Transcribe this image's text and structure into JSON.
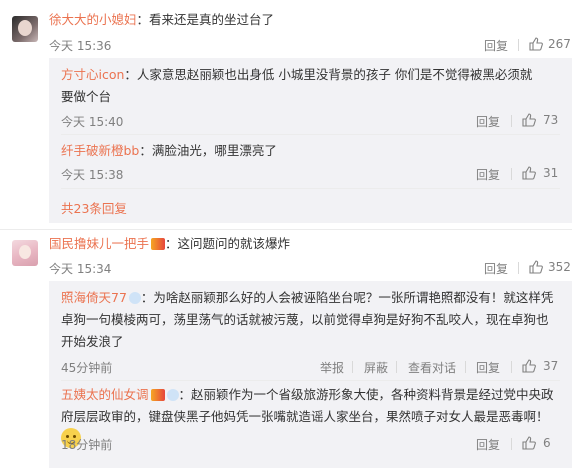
{
  "comments": [
    {
      "user": "徐大大的小媳妇",
      "text": "：看来还是真的坐过台了",
      "time": "今天 15:36",
      "reply_label": "回复",
      "likes": "267",
      "replies": [
        {
          "user": "方寸心icon",
          "text": "：人家意思赵丽颖也出身低 小城里没背景的孩子 你们是不觉得被黑必须就要做个台",
          "time": "今天 15:40",
          "reply_label": "回复",
          "likes": "73"
        },
        {
          "user": "纤手破新橙bb",
          "text": "：满脸油光，哪里漂亮了",
          "time": "今天 15:38",
          "reply_label": "回复",
          "likes": "31"
        }
      ],
      "more_replies": "共23条回复"
    },
    {
      "user": "国民撸妹儿一把手",
      "text": "：这问题问的就该爆炸",
      "time": "今天 15:34",
      "reply_label": "回复",
      "likes": "352",
      "replies": [
        {
          "user": "照海倚天77",
          "text": "：为啥赵丽颖那么好的人会被诬陷坐台呢？一张所谓艳照都没有！就这样凭卓狗一句模棱两可，荡里荡气的话就被污蔑，以前觉得卓狗是好狗不乱咬人，现在卓狗也开始发浪了",
          "time": "45分钟前",
          "report_label": "举报",
          "block_label": "屏蔽",
          "view_label": "查看对话",
          "reply_label": "回复",
          "likes": "37"
        },
        {
          "user": "五姨太的仙女调",
          "text": "：赵丽颖作为一个省级旅游形象大使，各种资料背景是经过党中央政府层层政审的，键盘侠黑子他妈凭一张嘴就造谣人家坐台，果然喷子对女人最是恶毒啊！",
          "time": "18分钟前",
          "reply_label": "回复",
          "likes": "6"
        }
      ]
    }
  ],
  "colors": {
    "name": "#eb7350",
    "gray": "#808080",
    "reply_bg": "#f2f2f5"
  }
}
